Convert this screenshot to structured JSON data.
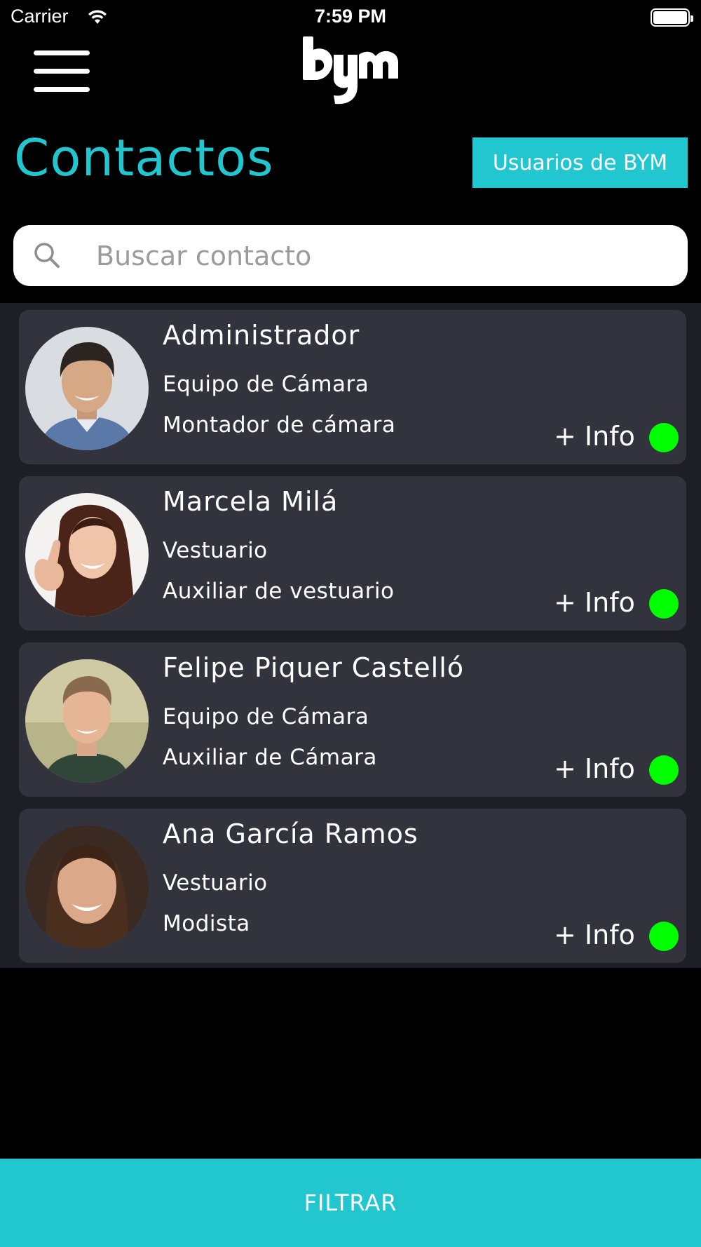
{
  "status_bar": {
    "carrier": "Carrier",
    "time": "7:59 PM"
  },
  "header": {
    "logo_icon": "bym-logo-icon",
    "menu_icon": "hamburger-menu-icon"
  },
  "page": {
    "title": "Contactos",
    "users_button_label": "Usuarios de BYM"
  },
  "search": {
    "placeholder": "Buscar contacto",
    "value": ""
  },
  "contacts": [
    {
      "name": "Administrador",
      "department": "Equipo de Cámara",
      "role": "Montador de cámara",
      "info_label": "+ Info",
      "status": "online"
    },
    {
      "name": "Marcela Milá",
      "department": "Vestuario",
      "role": "Auxiliar de vestuario",
      "info_label": "+ Info",
      "status": "online"
    },
    {
      "name": "Felipe Piquer Castelló",
      "department": "Equipo de Cámara",
      "role": "Auxiliar de Cámara",
      "info_label": "+ Info",
      "status": "online"
    },
    {
      "name": "Ana García Ramos",
      "department": "Vestuario",
      "role": "Modista",
      "info_label": "+ Info",
      "status": "online"
    }
  ],
  "footer": {
    "filter_label": "FILTRAR"
  },
  "colors": {
    "accent": "#22c6cf",
    "background": "#000000",
    "list_background": "#1e1e27",
    "card_background": "#33333e",
    "status_online": "#00ff00"
  }
}
